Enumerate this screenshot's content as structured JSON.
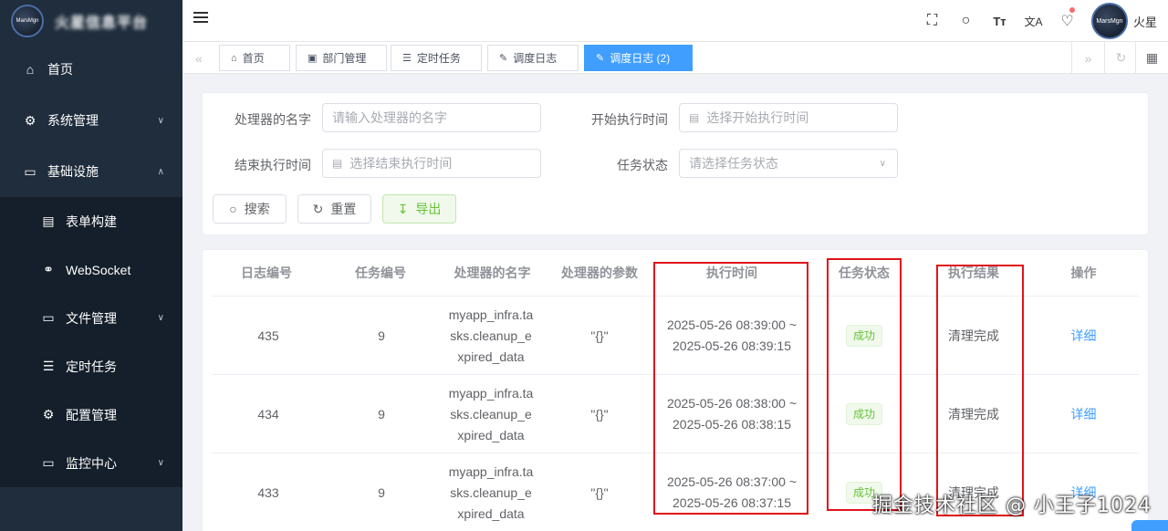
{
  "sidebar": {
    "logo_text": "MarsMgn",
    "brand": "火星信息平台",
    "items": [
      {
        "label": "首页",
        "icon": "home-icon",
        "glyph": "⌂"
      },
      {
        "label": "系统管理",
        "icon": "gear-icon",
        "glyph": "⚙"
      },
      {
        "label": "基础设施",
        "icon": "monitor-icon",
        "glyph": "▭"
      }
    ],
    "subitems": [
      {
        "label": "表单构建",
        "icon": "form-icon",
        "glyph": "▤"
      },
      {
        "label": "WebSocket",
        "icon": "link-icon",
        "glyph": "⚭"
      },
      {
        "label": "文件管理",
        "icon": "folder-icon",
        "glyph": "▭"
      },
      {
        "label": "定时任务",
        "icon": "task-list-icon",
        "glyph": "☰"
      },
      {
        "label": "配置管理",
        "icon": "config-icon",
        "glyph": "⚙"
      },
      {
        "label": "监控中心",
        "icon": "monitor-icon",
        "glyph": "▭"
      }
    ]
  },
  "header": {
    "user_name": "火星",
    "avatar_text": "MarsMgn",
    "tools": [
      "fullscreen-icon",
      "search-icon",
      "font-size-icon",
      "translate-icon",
      "bell-icon"
    ],
    "tool_glyphs": [
      "⛶",
      "○",
      "Tт",
      "文A",
      "🔔"
    ]
  },
  "tags": [
    {
      "label": "首页",
      "glyph": "⌂"
    },
    {
      "label": "部门管理",
      "glyph": "▣"
    },
    {
      "label": "定时任务",
      "glyph": "☰"
    },
    {
      "label": "调度日志",
      "glyph": "✎"
    },
    {
      "label": "调度日志 (2)",
      "glyph": "✎",
      "active": true
    }
  ],
  "search": {
    "handler_label": "处理器的名字",
    "handler_placeholder": "请输入处理器的名字",
    "start_label": "开始执行时间",
    "start_placeholder": "选择开始执行时间",
    "end_label": "结束执行时间",
    "end_placeholder": "选择结束执行时间",
    "status_label": "任务状态",
    "status_placeholder": "请选择任务状态",
    "search_btn": "搜索",
    "reset_btn": "重置",
    "export_btn": "导出"
  },
  "table": {
    "columns": [
      "日志编号",
      "任务编号",
      "处理器的名字",
      "处理器的参数",
      "执行时间",
      "任务状态",
      "执行结果",
      "操作"
    ],
    "rows": [
      {
        "id": "435",
        "job_id": "9",
        "handler": "myapp_infra.tasks.cleanup_expired_data",
        "params": "\"{}\"",
        "time_start": "2025-05-26 08:39:00 ~",
        "time_end": "2025-05-26 08:39:15",
        "status": "成功",
        "result": "清理完成",
        "action": "详细"
      },
      {
        "id": "434",
        "job_id": "9",
        "handler": "myapp_infra.tasks.cleanup_expired_data",
        "params": "\"{}\"",
        "time_start": "2025-05-26 08:38:00 ~",
        "time_end": "2025-05-26 08:38:15",
        "status": "成功",
        "result": "清理完成",
        "action": "详细"
      },
      {
        "id": "433",
        "job_id": "9",
        "handler": "myapp_infra.tasks.cleanup_expired_data",
        "params": "\"{}\"",
        "time_start": "2025-05-26 08:37:00 ~",
        "time_end": "2025-05-26 08:37:15",
        "status": "成功",
        "result": "清理完成",
        "action": "详细"
      }
    ]
  },
  "watermark": "掘金技术社区 @ 小王子1024",
  "colors": {
    "accent": "#409eff",
    "sidebar": "#1f2d3d",
    "success": "#67c23a",
    "highlight_box": "#e0131a"
  }
}
